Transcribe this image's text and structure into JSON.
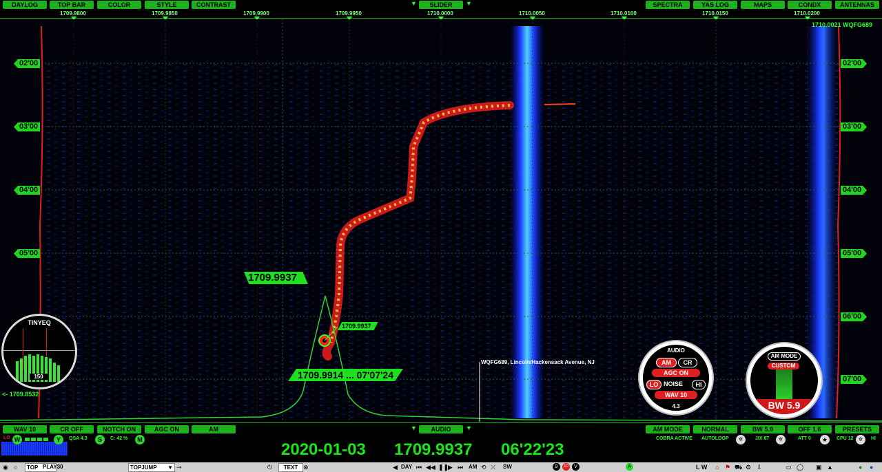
{
  "top_bar_left": [
    "DAYLOG",
    "TOP BAR",
    "COLOR",
    "STYLE",
    "CONTRAST"
  ],
  "top_bar_center": "SLIDER",
  "top_bar_right": [
    "SPECTRA",
    "YAS LOG",
    "MAPS",
    "CONDX",
    "ANTENNAS"
  ],
  "freq_scale": [
    "1709.9800",
    "1709.9850",
    "1709.9900",
    "1709.9950",
    "1710.0000",
    "1710.0050",
    "1710.0100",
    "1710.0150",
    "1710.0200"
  ],
  "station_tag": "1710.0021 WQFG689",
  "time_labels": [
    "02'00",
    "03'00",
    "04'00",
    "05'00",
    "06'00",
    "07'00"
  ],
  "marker_freq": "1709.9937",
  "marker_small": "1709.9937",
  "marker_bottom": "1709.9914 ... 07'07'24",
  "station_label": "WQFG689, Lincoln/Hackensack Avenue, NJ",
  "tinyeq": {
    "title": "TINYEQ",
    "value": "150",
    "freq": "<- 1709.8532"
  },
  "audio_panel": {
    "title": "AUDIO",
    "am": "AM",
    "cr": "CR",
    "agc": "AGC ON",
    "lo": "LO",
    "noise": "NOISE",
    "hi": "HI",
    "wav": "WAV 10",
    "value": "4.3"
  },
  "bw_panel": {
    "mode": "AM MODE",
    "custom": "CUSTOM",
    "bw": "BW 5.9"
  },
  "bottom_bar_left": [
    "WAV 10",
    "CR OFF",
    "NOTCH ON",
    "AGC ON",
    "AM"
  ],
  "bottom_bar_center": "AUDIO",
  "bottom_bar_right": [
    "AM MODE",
    "NORMAL",
    "BW 5.9",
    "OFF 1.6",
    "PRESETS"
  ],
  "status_left": {
    "lo": "LO",
    "qsa": "QSA 4.3",
    "c": "C: 42 %"
  },
  "status_right": [
    "COBRA ACTIVE",
    "AUTOLOOP",
    "JIX 87",
    "ATT 0",
    "CPU 12",
    "HI"
  ],
  "readout": {
    "date": "2020-01-03",
    "freq": "1709.9937",
    "time": "06'22'23"
  },
  "taskbar": {
    "top": "TOP",
    "play": "PLAY30",
    "topjump": "TOPJUMP",
    "text": "TEXT",
    "day": "DAY",
    "am": "AM",
    "sw": "SW",
    "lw": "L W"
  },
  "colors": {
    "accent": "#1db11d",
    "readout": "#19e619",
    "text": "#7dff7d"
  }
}
